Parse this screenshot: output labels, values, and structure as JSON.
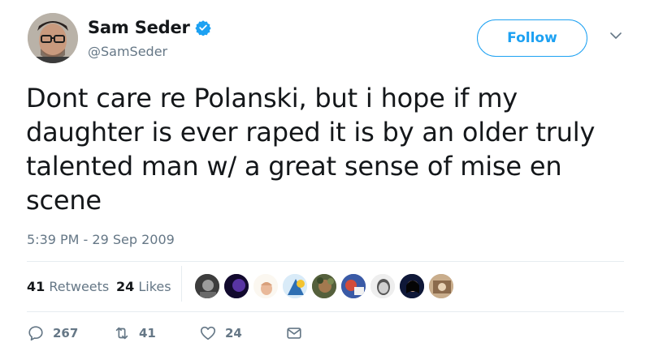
{
  "user": {
    "display_name": "Sam Seder",
    "handle": "@SamSeder"
  },
  "follow_label": "Follow",
  "tweet": {
    "lines": [
      "Dont care re Polanski, but i hope if my",
      "daughter is ever raped it is by an older truly",
      "talented man w/ a great sense of mise en",
      "scene"
    ],
    "timestamp": "5:39 PM - 29 Sep 2009"
  },
  "stats": {
    "retweets_count": "41",
    "retweets_label": "Retweets",
    "likes_count": "24",
    "likes_label": "Likes"
  },
  "actions": {
    "reply_count": "267",
    "retweet_count": "41",
    "like_count": "24"
  },
  "colors": {
    "accent": "#1da1f2",
    "muted": "#657786",
    "text": "#14171a"
  },
  "icons": [
    "verified-badge-icon",
    "chevron-down-icon",
    "reply-icon",
    "retweet-icon",
    "heart-icon",
    "message-icon"
  ]
}
